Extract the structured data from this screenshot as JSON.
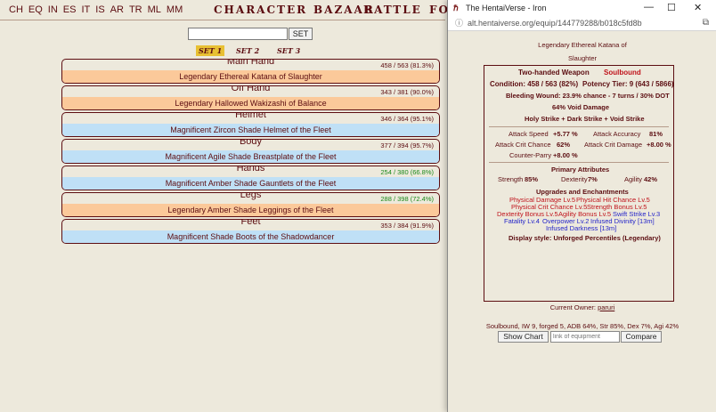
{
  "nav": {
    "languages": [
      "CH",
      "EQ",
      "IN",
      "ES",
      "IT",
      "IS",
      "AR",
      "TR",
      "ML",
      "MM"
    ],
    "menus": [
      "CHARACTER",
      "BAZAAR",
      "BATTLE",
      "FO"
    ]
  },
  "set_controls": {
    "input_value": "",
    "button_label": "SET",
    "tabs": [
      "SET 1",
      "SET 2",
      "SET 3"
    ],
    "active_tab": "SET 1"
  },
  "slots": [
    {
      "label": "Main Hand",
      "item": "Legendary Ethereal Katana of Slaughter",
      "condition": "458 / 563 (81.3%)",
      "color": "orange",
      "cond_color": "normal"
    },
    {
      "label": "Off Hand",
      "item": "Legendary Hallowed Wakizashi of Balance",
      "condition": "343 / 381 (90.0%)",
      "color": "orange",
      "cond_color": "normal"
    },
    {
      "label": "Helmet",
      "item": "Magnificent Zircon Shade Helmet of the Fleet",
      "condition": "346 / 364 (95.1%)",
      "color": "blue",
      "cond_color": "normal"
    },
    {
      "label": "Body",
      "item": "Magnificent Agile Shade Breastplate of the Fleet",
      "condition": "377 / 394 (95.7%)",
      "color": "blue",
      "cond_color": "normal"
    },
    {
      "label": "Hands",
      "item": "Magnificent Amber Shade Gauntlets of the Fleet",
      "condition": "254 / 380 (66.8%)",
      "color": "blue",
      "cond_color": "green"
    },
    {
      "label": "Legs",
      "item": "Legendary Amber Shade Leggings of the Fleet",
      "condition": "288 / 398 (72.4%)",
      "color": "orange",
      "cond_color": "green"
    },
    {
      "label": "Feet",
      "item": "Magnificent Shade Boots of the Shadowdancer",
      "condition": "353 / 384 (91.9%)",
      "color": "blue",
      "cond_color": "normal"
    }
  ],
  "popup": {
    "title": "The HentaiVerse - Iron",
    "url": "alt.hentaiverse.org/equip/144779288/b018c5fd8b",
    "equip_name_line1": "Legendary Ethereal Katana of",
    "equip_name_line2": "Slaughter",
    "weapon_type": "Two-handed Weapon",
    "soulbound": "Soulbound",
    "condition": "Condition: 458 / 563 (82%)",
    "potency": "Potency Tier: 9 (643 / 5866)",
    "bleeding": "Bleeding Wound: 23.9% chance - 7 turns / 30% DOT",
    "void_damage": "64% Void Damage",
    "strikes": "Holy Strike + Dark Strike + Void Strike",
    "stats": [
      {
        "label": "Attack Speed",
        "value": "+5.77 %"
      },
      {
        "label": "Attack Accuracy",
        "value": "81%"
      },
      {
        "label": "Attack Crit Chance",
        "value": "62%"
      },
      {
        "label": "Attack Crit Damage",
        "value": "+8.00 %"
      },
      {
        "label": "Counter-Parry",
        "value": "+8.00 %"
      }
    ],
    "primary_title": "Primary Attributes",
    "primary": [
      {
        "label": "Strength",
        "value": "85%"
      },
      {
        "label": "Dexterity",
        "value": "7%"
      },
      {
        "label": "Agility",
        "value": "42%"
      }
    ],
    "upgrades_title": "Upgrades and Enchantments",
    "upgrades_line1": [
      "Physical Damage Lv.5",
      "Physical Hit Chance Lv.5"
    ],
    "upgrades_line2": [
      "Physical Crit Chance Lv.5",
      "Strength Bonus Lv.5"
    ],
    "upgrades_line3_red": [
      "Dexterity Bonus Lv.5",
      "Agility Bonus Lv.5"
    ],
    "upgrades_line3_blue": "Swift Strike Lv.3",
    "upgrades_line4": [
      "Fatality Lv.4",
      "Overpower Lv.2",
      "Infused Divinity [13m]"
    ],
    "upgrades_line5": "Infused Darkness [13m]",
    "display_style": "Display style: Unforged Percentiles (Legendary)",
    "owner_label": "Current Owner:",
    "owner_name": "paruri",
    "summary": "Soulbound, IW 9, forged 5, ADB 64%, Str 85%, Dex 7%, Agi 42%",
    "show_chart_label": "Show Chart",
    "link_placeholder": "link of equipment",
    "compare_label": "Compare"
  },
  "colors": {
    "text": "#5c0d11",
    "background": "#ede9dc",
    "orange_bar": "#fbc99a",
    "blue_bar": "#bfe0f6",
    "active_set": "#e8c033",
    "red_text": "#c0131b",
    "blue_text": "#2525c9"
  }
}
